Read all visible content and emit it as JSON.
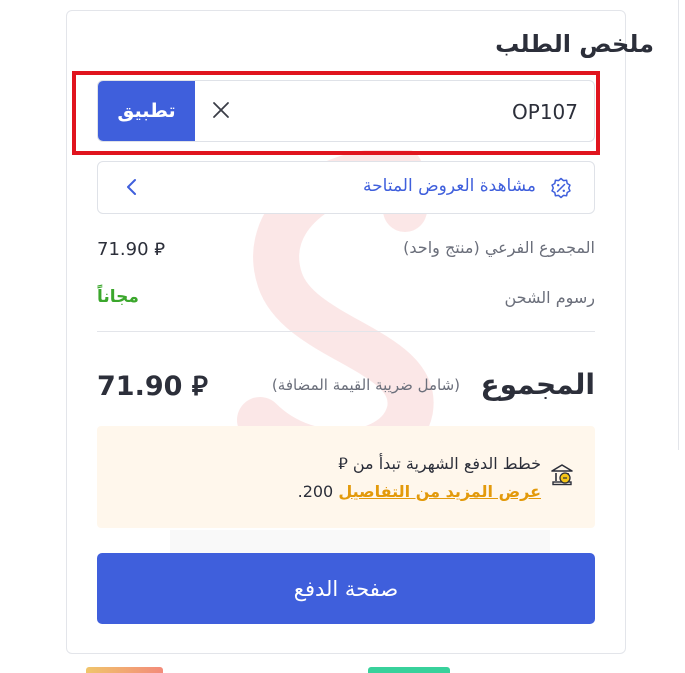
{
  "summary": {
    "title": "ملخص الطلب",
    "coupon": {
      "value": "OP107",
      "apply_label": "تطبيق"
    },
    "offers_label": "مشاهدة العروض المتاحة",
    "subtotal_label": "المجموع الفرعي (منتج واحد)",
    "subtotal_value": "71.90 ⃁",
    "shipping_label": "رسوم الشحن",
    "shipping_value": "مجاناً",
    "total_label": "المجموع",
    "total_note": "(شامل ضريبة القيمة المضافة)",
    "total_value": "71.90 ⃁",
    "installment_line1": "خطط الدفع الشهرية تبدأ من ⃁",
    "installment_amount": "200.",
    "installment_link": "عرض المزيد من التفاصيل",
    "checkout_label": "صفحة الدفع"
  },
  "colors": {
    "primary": "#3f5fdc",
    "highlight_border": "#e0141e",
    "free_text": "#3ba72c",
    "link": "#e39a0b",
    "installment_bg": "#fff7ec"
  },
  "icons": {
    "clear": "close-icon",
    "offers": "discount-badge-icon",
    "chevron": "chevron-left-icon",
    "installment": "installment-bank-icon"
  }
}
